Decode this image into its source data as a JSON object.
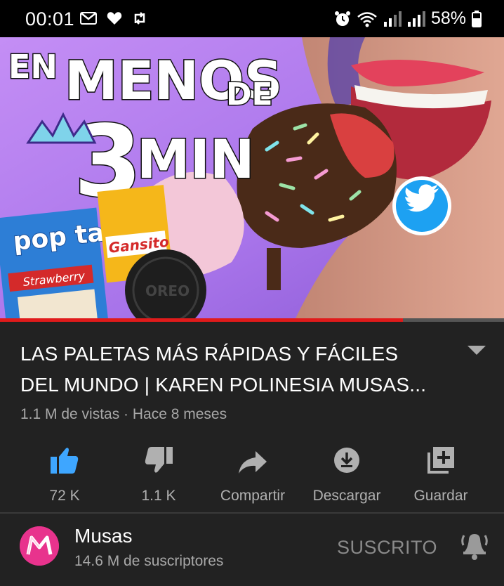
{
  "status_bar": {
    "time": "00:01",
    "battery_text": "58%",
    "icons": [
      "gmail-icon",
      "heart-icon",
      "retweet-icon",
      "alarm-icon",
      "wifi-icon",
      "signal-icon",
      "signal-icon",
      "battery-icon"
    ]
  },
  "video": {
    "thumbnail_text": [
      "EN",
      "MENOS",
      "DE",
      "3",
      "MIN"
    ],
    "thumbnail_products": [
      "pop tarts",
      "Strawberry",
      "Gansito",
      "OREO"
    ],
    "progress": 0.8,
    "title_line1": "LAS PALETAS MÁS RÁPIDAS Y FÁCILES",
    "title_line2": "DEL MUNDO | KAREN POLINESIA MUSAS...",
    "meta": "1.1 M de vistas · Hace 8 meses"
  },
  "actions": {
    "like_label": "72 K",
    "dislike_label": "1.1 K",
    "share_label": "Compartir",
    "download_label": "Descargar",
    "save_label": "Guardar"
  },
  "channel": {
    "name": "Musas",
    "subscribers": "14.6 M de suscriptores",
    "subscribed_label": "SUSCRITO"
  },
  "colors": {
    "accent_like": "#3ea6ff",
    "progress": "#e01b1b",
    "avatar": "#e8338d",
    "twitter": "#1da1f2"
  }
}
